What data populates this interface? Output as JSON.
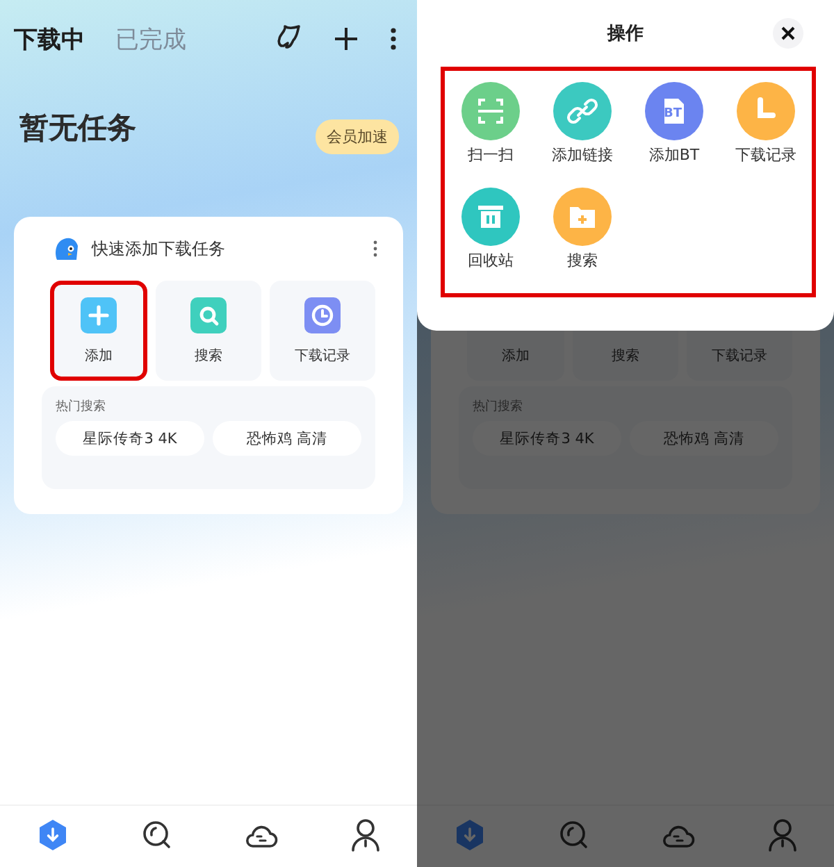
{
  "screens": [
    {
      "kind": "page",
      "header_tabs": [
        {
          "label": "下载中",
          "selected": true
        },
        {
          "label": "已完成",
          "selected": false
        }
      ],
      "title": "暂无任务",
      "badge": "会员加速",
      "card": {
        "title": "快速添加下载任务",
        "tiles": [
          {
            "label": "添加",
            "color": "#4fc3f7",
            "highlighted": true
          },
          {
            "label": "搜索",
            "color": "#3fd0bd",
            "highlighted": false
          },
          {
            "label": "下载记录",
            "color": "#7d8ef3",
            "highlighted": false
          }
        ],
        "hot_search": {
          "label": "热门搜索",
          "terms": [
            "星际传奇3 4K",
            "恐怖鸡 高清"
          ]
        }
      },
      "tab_bar": [
        {
          "selected": true
        },
        {
          "selected": false
        },
        {
          "selected": false
        },
        {
          "selected": false
        }
      ]
    },
    {
      "kind": "dimmed",
      "card": {
        "tiles": [
          {
            "label": "添加",
            "highlighted": false
          },
          {
            "label": "搜索",
            "highlighted": false
          },
          {
            "label": "下载记录",
            "highlighted": false
          }
        ],
        "hot_search": {
          "label": "热门搜索",
          "terms": [
            "星际传奇3 4K",
            "恐怖鸡 高清"
          ]
        }
      },
      "tab_bar": [
        {
          "selected": true
        },
        {
          "selected": false
        },
        {
          "selected": false
        },
        {
          "selected": false
        }
      ],
      "sheet": {
        "title": "操作",
        "highlighted": true,
        "actions": [
          {
            "label": "扫一扫",
            "color": "#6ccf8a"
          },
          {
            "label": "添加链接",
            "color": "#3cc9c0"
          },
          {
            "label": "添加BT",
            "color": "#6b84f0",
            "icon_text": "BT"
          },
          {
            "label": "下载记录",
            "color": "#fdb446"
          },
          {
            "label": "回收站",
            "color": "#2fc6bf"
          },
          {
            "label": "搜索",
            "color": "#fdb446"
          }
        ]
      }
    }
  ]
}
